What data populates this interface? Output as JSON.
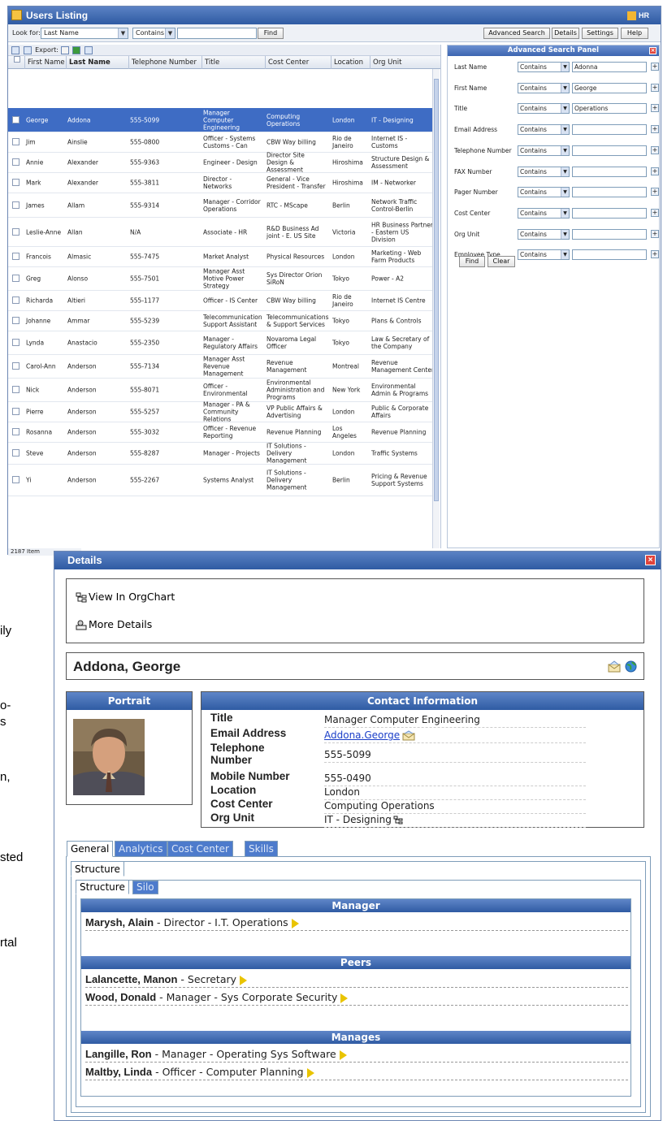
{
  "bg_fragments": [
    "ily",
    "o-",
    "s",
    "n,",
    "sted",
    "rtal"
  ],
  "users_window": {
    "title": "Users Listing",
    "hr_label": "HR",
    "look_for_label": "Look for:",
    "look_for_field": "Last Name",
    "look_for_op": "Contains",
    "search_value": "",
    "find_label": "Find",
    "top_buttons": [
      "Advanced Search",
      "Details",
      "Settings",
      "Help"
    ],
    "export_label": "Export:",
    "columns": [
      "First Name",
      "Last Name",
      "Telephone Number",
      "Title",
      "Cost Center",
      "Location",
      "Org Unit"
    ],
    "rows": [
      {
        "first": "George",
        "last": "Addona",
        "phone": "555-5099",
        "title": "Manager Computer Engineering",
        "cc": "Computing Operations",
        "loc": "London",
        "org": "IT - Designing",
        "selected": true
      },
      {
        "first": "Jim",
        "last": "Ainslie",
        "phone": "555-0800",
        "title": "Officer - Systems Customs - Can",
        "cc": "CBW Way billing",
        "loc": "Rio de Janeiro",
        "org": "Internet IS - Customs"
      },
      {
        "first": "Annie",
        "last": "Alexander",
        "phone": "555-9363",
        "title": "Engineer - Design",
        "cc": "Director Site Design & Assessment",
        "loc": "Hiroshima",
        "org": "Structure Design & Assessment"
      },
      {
        "first": "Mark",
        "last": "Alexander",
        "phone": "555-3811",
        "title": "Director - Networks",
        "cc": "General - Vice President - Transfer",
        "loc": "Hiroshima",
        "org": "IM - Networker"
      },
      {
        "first": "James",
        "last": "Allam",
        "phone": "555-9314",
        "title": "Manager - Corridor Operations",
        "cc": "RTC - MScape",
        "loc": "Berlin",
        "org": "Network Traffic Control-Berlin"
      },
      {
        "first": "Leslie-Anne",
        "last": "Allan",
        "phone": "N/A",
        "title": "Associate - HR",
        "cc": "R&D Business Ad joint - E. US Site",
        "loc": "Victoria",
        "org": "HR Business Partner - Eastern US Division"
      },
      {
        "first": "Francois",
        "last": "Almasic",
        "phone": "555-7475",
        "title": "Market Analyst",
        "cc": "Physical Resources",
        "loc": "London",
        "org": "Marketing - Web Farm Products"
      },
      {
        "first": "Greg",
        "last": "Alonso",
        "phone": "555-7501",
        "title": "Manager Asst Motive Power Strategy",
        "cc": "Sys Director Orion SiRoN",
        "loc": "Tokyo",
        "org": "Power - A2"
      },
      {
        "first": "Richarda",
        "last": "Altieri",
        "phone": "555-1177",
        "title": "Officer - IS Center",
        "cc": "CBW Way billing",
        "loc": "Rio de Janeiro",
        "org": "Internet IS Centre"
      },
      {
        "first": "Johanne",
        "last": "Ammar",
        "phone": "555-5239",
        "title": "Telecommunication Support Assistant",
        "cc": "Telecommunications & Support Services",
        "loc": "Tokyo",
        "org": "Plans & Controls"
      },
      {
        "first": "Lynda",
        "last": "Anastacio",
        "phone": "555-2350",
        "title": "Manager - Regulatory Affairs",
        "cc": "Novaroma Legal Officer",
        "loc": "Tokyo",
        "org": "Law & Secretary of the Company"
      },
      {
        "first": "Carol-Ann",
        "last": "Anderson",
        "phone": "555-7134",
        "title": "Manager Asst Revenue Management",
        "cc": "Revenue Management",
        "loc": "Montreal",
        "org": "Revenue Management Center"
      },
      {
        "first": "Nick",
        "last": "Anderson",
        "phone": "555-8071",
        "title": "Officer - Environmental",
        "cc": "Environmental Administration and Programs",
        "loc": "New York",
        "org": "Environmental Admin & Programs"
      },
      {
        "first": "Pierre",
        "last": "Anderson",
        "phone": "555-5257",
        "title": "Manager - PA & Community Relations",
        "cc": "VP Public Affairs & Advertising",
        "loc": "London",
        "org": "Public & Corporate Affairs"
      },
      {
        "first": "Rosanna",
        "last": "Anderson",
        "phone": "555-3032",
        "title": "Officer - Revenue Reporting",
        "cc": "Revenue Planning",
        "loc": "Los Angeles",
        "org": "Revenue Planning"
      },
      {
        "first": "Steve",
        "last": "Anderson",
        "phone": "555-8287",
        "title": "Manager - Projects",
        "cc": "IT Solutions - Delivery Management",
        "loc": "London",
        "org": "Traffic Systems"
      },
      {
        "first": "Yi",
        "last": "Anderson",
        "phone": "555-2267",
        "title": "Systems Analyst",
        "cc": "IT Solutions - Delivery Management",
        "loc": "Berlin",
        "org": "Pricing & Revenue Support Systems"
      }
    ],
    "status": "2187 Item"
  },
  "advanced_search": {
    "title": "Advanced Search Panel",
    "fields": [
      {
        "label": "Last Name",
        "op": "Contains",
        "value": "Adonna"
      },
      {
        "label": "First Name",
        "op": "Contains",
        "value": "George"
      },
      {
        "label": "Title",
        "op": "Contains",
        "value": "Operations"
      },
      {
        "label": "Email Address",
        "op": "Contains",
        "value": ""
      },
      {
        "label": "Telephone Number",
        "op": "Contains",
        "value": ""
      },
      {
        "label": "FAX Number",
        "op": "Contains",
        "value": ""
      },
      {
        "label": "Pager Number",
        "op": "Contains",
        "value": ""
      },
      {
        "label": "Cost Center",
        "op": "Contains",
        "value": ""
      },
      {
        "label": "Org Unit",
        "op": "Contains",
        "value": ""
      },
      {
        "label": "Employee Type",
        "op": "Contains",
        "value": ""
      }
    ],
    "find_label": "Find",
    "clear_label": "Clear"
  },
  "details": {
    "title": "Details",
    "view_orgchart": "View In OrgChart",
    "more_details": "More Details",
    "name": "Addona, George",
    "portrait_header": "Portrait",
    "contact_header": "Contact Information",
    "contact": [
      {
        "k": "Title",
        "v": "Manager Computer Engineering"
      },
      {
        "k": "Email Address",
        "v": "Addona.George"
      },
      {
        "k": "Telephone Number",
        "v": "555-5099"
      },
      {
        "k": "Mobile Number",
        "v": "555-0490"
      },
      {
        "k": "Location",
        "v": "London"
      },
      {
        "k": "Cost Center",
        "v": "Computing Operations"
      },
      {
        "k": "Org Unit",
        "v": "IT - Designing"
      }
    ],
    "tabs": [
      "General",
      "Analytics",
      "Cost Center",
      "Skills"
    ],
    "subtab": "Structure",
    "inner_tabs": [
      "Structure",
      "Silo"
    ],
    "manager_header": "Manager",
    "manager": [
      {
        "name": "Marysh, Alain",
        "role": " - Director - I.T. Operations"
      }
    ],
    "peers_header": "Peers",
    "peers": [
      {
        "name": "Lalancette, Manon",
        "role": " - Secretary"
      },
      {
        "name": "Wood, Donald",
        "role": " - Manager - Sys Corporate Security"
      }
    ],
    "manages_header": "Manages",
    "manages": [
      {
        "name": "Langille, Ron",
        "role": " - Manager - Operating Sys Software"
      },
      {
        "name": "Maltby, Linda",
        "role": " - Officer - Computer Planning"
      }
    ]
  }
}
